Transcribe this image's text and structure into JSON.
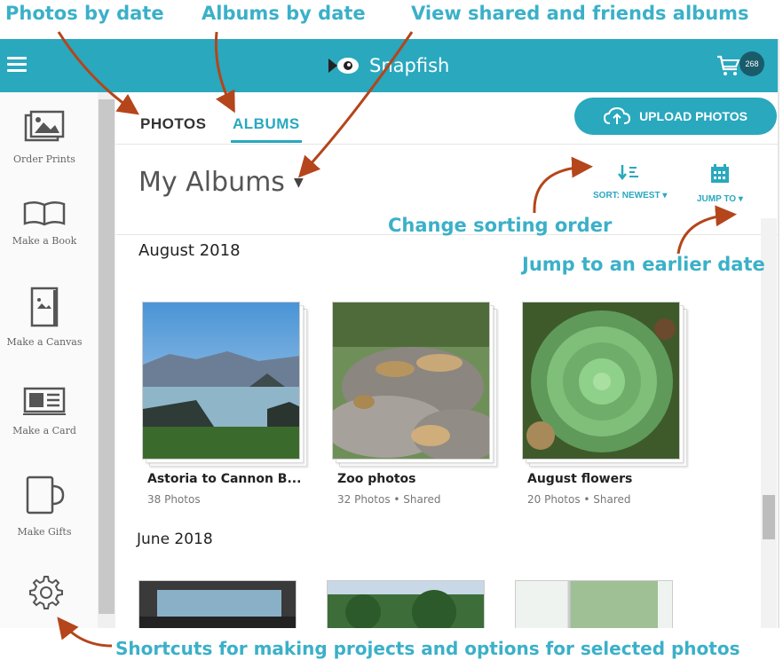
{
  "annotations": {
    "photos_by_date": "Photos by date",
    "albums_by_date": "Albums by date",
    "view_shared": "View shared and friends albums",
    "change_sorting": "Change sorting order",
    "jump_earlier": "Jump to an earlier date",
    "shortcuts": "Shortcuts for making projects and options for selected photos"
  },
  "header": {
    "brand": "Snapfish",
    "cart_count": "268",
    "brand_color": "#29a8be"
  },
  "sidebar": {
    "items": [
      {
        "label": "Order Prints",
        "icon": "prints-icon"
      },
      {
        "label": "Make a Book",
        "icon": "book-icon"
      },
      {
        "label": "Make a Canvas",
        "icon": "canvas-icon"
      },
      {
        "label": "Make a Card",
        "icon": "card-icon"
      },
      {
        "label": "Make Gifts",
        "icon": "mug-icon"
      }
    ],
    "settings_icon": "gear-icon"
  },
  "tabs": [
    {
      "label": "PHOTOS",
      "active": false
    },
    {
      "label": "ALBUMS",
      "active": true
    }
  ],
  "upload_button": "UPLOAD PHOTOS",
  "album_view": {
    "title": "My Albums",
    "sort_label": "SORT: NEWEST",
    "jump_label": "JUMP TO"
  },
  "sections": [
    {
      "title": "August 2018",
      "albums": [
        {
          "title": "Astoria to Cannon B...",
          "meta": "38 Photos"
        },
        {
          "title": "Zoo photos",
          "meta": "32 Photos • Shared"
        },
        {
          "title": "August flowers",
          "meta": "20 Photos • Shared"
        }
      ]
    },
    {
      "title": "June 2018",
      "albums": []
    }
  ]
}
